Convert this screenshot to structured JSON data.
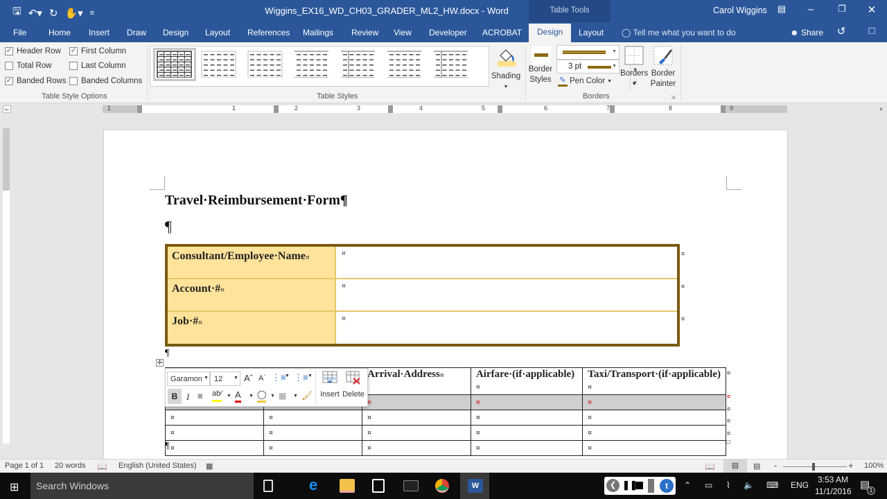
{
  "titlebar": {
    "document_title": "Wiggins_EX16_WD_CH03_GRADER_ML2_HW.docx  -  Word",
    "contextual_group": "Table Tools",
    "user_name": "Carol Wiggins",
    "qat_icons": [
      "save-icon",
      "undo-icon",
      "redo-icon",
      "touch-mode-icon",
      "customize-qat-icon"
    ],
    "window_controls": [
      "ribbon-display-options-icon",
      "minimize-icon",
      "restore-icon",
      "close-icon"
    ]
  },
  "tabs": [
    {
      "label": "File"
    },
    {
      "label": "Home"
    },
    {
      "label": "Insert"
    },
    {
      "label": "Draw"
    },
    {
      "label": "Design"
    },
    {
      "label": "Layout"
    },
    {
      "label": "References"
    },
    {
      "label": "Mailings"
    },
    {
      "label": "Review"
    },
    {
      "label": "View"
    },
    {
      "label": "Developer"
    },
    {
      "label": "ACROBAT"
    },
    {
      "label": "Design",
      "active": true
    },
    {
      "label": "Layout"
    }
  ],
  "tell_me": "Tell me what you want to do",
  "share": "Share",
  "ribbon": {
    "table_style_options": {
      "label": "Table Style Options",
      "options": [
        {
          "label": "Header Row",
          "checked": true
        },
        {
          "label": "First Column",
          "checked": true
        },
        {
          "label": "Total Row",
          "checked": false
        },
        {
          "label": "Last Column",
          "checked": false
        },
        {
          "label": "Banded Rows",
          "checked": true
        },
        {
          "label": "Banded Columns",
          "checked": false
        }
      ]
    },
    "table_styles": {
      "label": "Table Styles",
      "count_visible": 7,
      "selected_index": 0
    },
    "shading": {
      "label": "Shading",
      "color": "#ffe08a"
    },
    "borders": {
      "label": "Borders",
      "border_styles": "Border Styles",
      "line_weight": "3 pt",
      "pen_color": "Pen Color",
      "pen_color_value": "#8c6a14",
      "borders_btn": "Borders",
      "border_painter": "Border Painter"
    }
  },
  "ruler": {
    "numbers": [
      "1",
      "1",
      "2",
      "3",
      "4",
      "5",
      "6",
      "7",
      "8",
      "9"
    ]
  },
  "document": {
    "heading": "Travel·Reimbursement·Form¶",
    "pilcrow": "¶",
    "cell_marker": "¤",
    "table1": {
      "rows": [
        {
          "label": "Consultant/Employee·Name",
          "value": ""
        },
        {
          "label": "Account·#",
          "value": ""
        },
        {
          "label": "Job·#",
          "value": ""
        }
      ],
      "colors": {
        "border": "#7a5a12",
        "label_fill": "#ffe39a",
        "inner_border": "#e6c768"
      }
    },
    "table2": {
      "headers": [
        "",
        "",
        "Arrival·Address",
        "Airfare·(if·applicable)",
        "Taxi/Transport·(if·applicable)"
      ],
      "empty_rows": 4,
      "selected_row": 0
    }
  },
  "mini_toolbar": {
    "font": "Garamon",
    "size": "12",
    "insert": "Insert",
    "delete": "Delete",
    "bold": "B",
    "italic": "I",
    "highlight_color": "#ffff00",
    "font_color": "#e00000",
    "shading_color": "#f5c542"
  },
  "statusbar": {
    "page": "Page 1 of 1",
    "words": "20 words",
    "language": "English (United States)",
    "zoom": "100%",
    "zoom_minus": "-",
    "zoom_plus": "+"
  },
  "taskbar": {
    "search": "Search Windows",
    "apps": [
      "task-view-icon",
      "edge-icon",
      "file-explorer-icon",
      "store-icon",
      "cmd-icon",
      "chrome-icon",
      "word-icon"
    ],
    "lang": "ENG",
    "time": "3:53 AM",
    "date": "11/1/2016",
    "notification_count": "1"
  }
}
